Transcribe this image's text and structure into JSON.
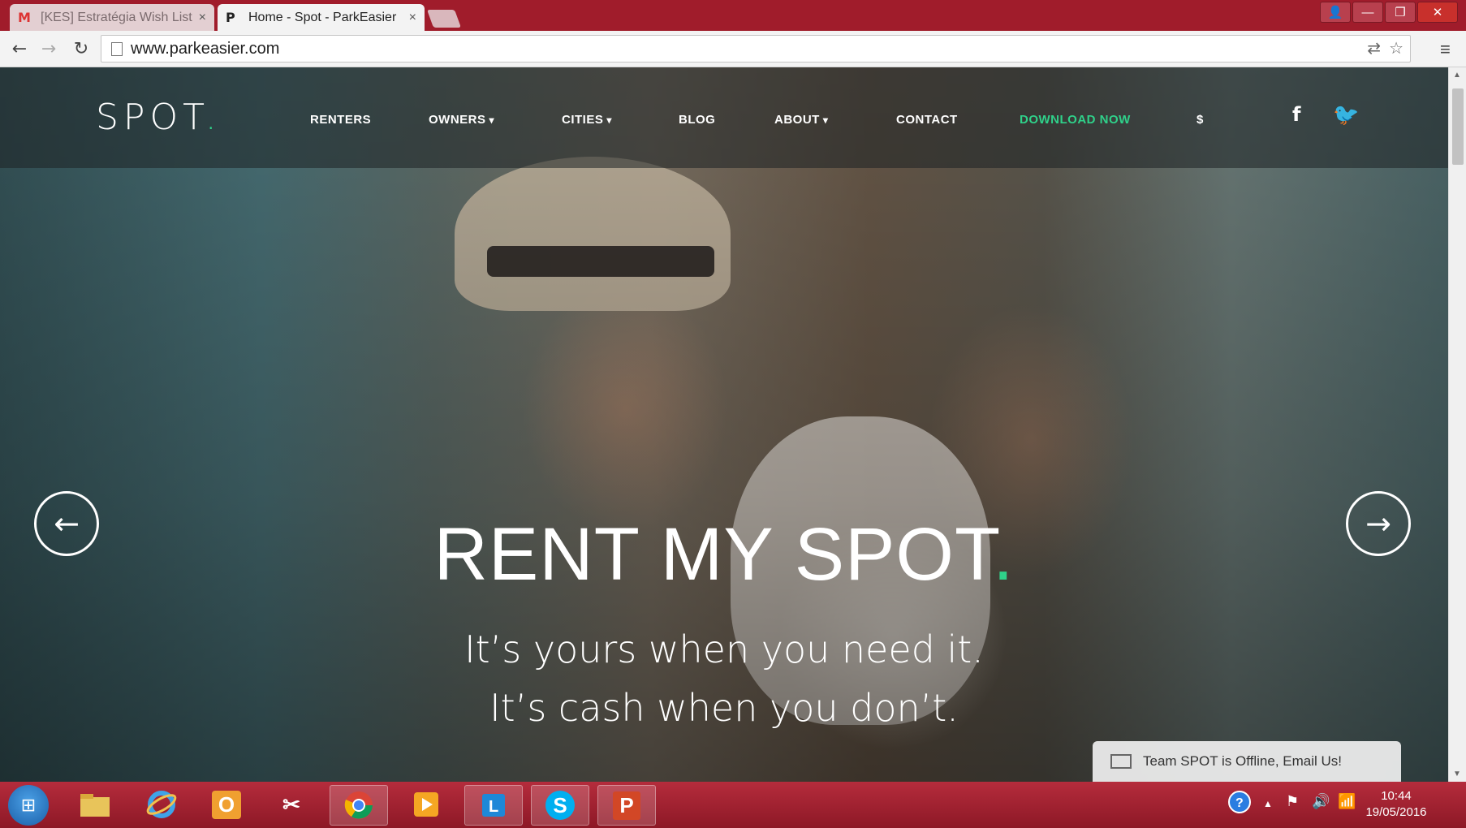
{
  "browser": {
    "tabs": [
      {
        "favicon": "M",
        "title": "[KES] Estratégia Wish List",
        "close": "×",
        "active": false
      },
      {
        "favicon": "P",
        "title": "Home - Spot - ParkEasier",
        "close": "×",
        "active": true
      }
    ],
    "url": "www.parkeasier.com",
    "nav": {
      "back": "←",
      "forward": "→",
      "reload": "↻"
    },
    "window_buttons": {
      "user": "👤",
      "minimize": "—",
      "restore": "❐",
      "close": "✕"
    }
  },
  "site": {
    "logo": "SPOT",
    "logo_dot": ".",
    "nav": [
      {
        "label": "RENTERS",
        "dropdown": false
      },
      {
        "label": "OWNERS",
        "dropdown": true
      },
      {
        "label": "CITIES",
        "dropdown": true
      },
      {
        "label": "BLOG",
        "dropdown": false
      },
      {
        "label": "ABOUT",
        "dropdown": true
      },
      {
        "label": "CONTACT",
        "dropdown": false
      },
      {
        "label": "DOWNLOAD NOW",
        "dropdown": false
      },
      {
        "label": "$",
        "dropdown": false
      }
    ],
    "social": {
      "facebook": "f",
      "twitter": "t"
    },
    "accent_color": "#2fd18a"
  },
  "hero": {
    "title": "RENT MY SPOT",
    "title_dot": ".",
    "line1": "It’s yours when you need it.",
    "line2": "It’s cash when you don’t.",
    "prev_arrow": "←",
    "next_arrow": "→"
  },
  "chat": {
    "text": "Team SPOT is Offline, Email Us!"
  },
  "taskbar": {
    "apps": [
      "file-explorer",
      "internet-explorer",
      "outlook",
      "snipping-tool",
      "chrome",
      "media-player",
      "lync",
      "skype",
      "powerpoint"
    ],
    "outlook_label": "O",
    "skype_label": "S",
    "ppt_label": "P",
    "clock_time": "10:44",
    "clock_date": "19/05/2016"
  }
}
